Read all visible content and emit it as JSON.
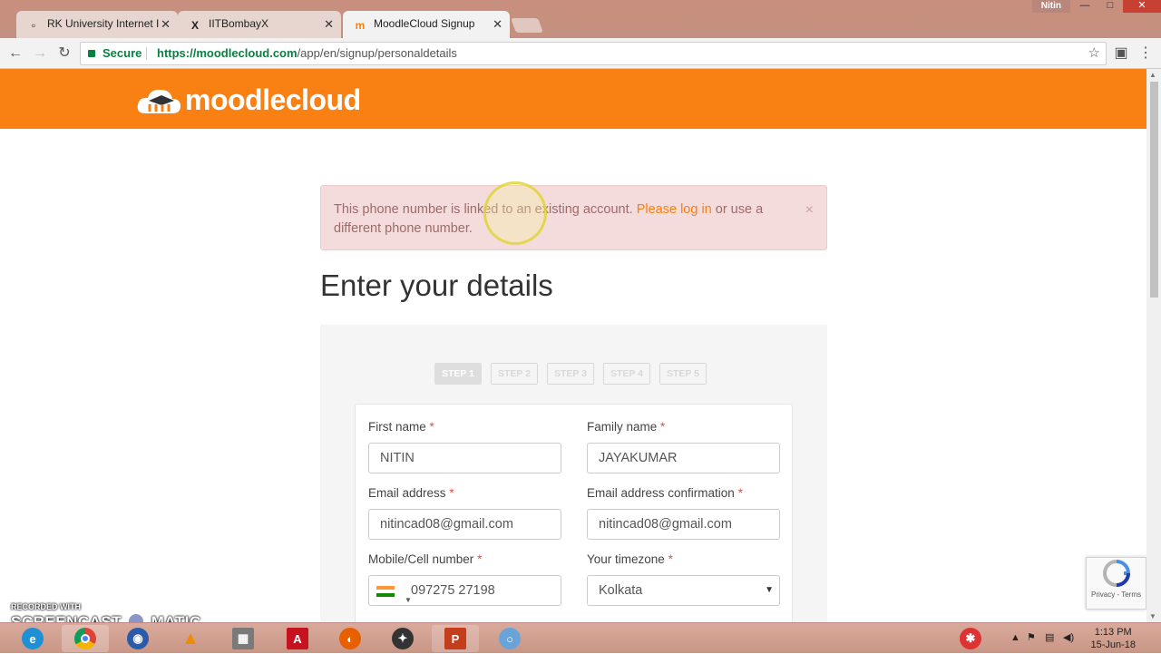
{
  "browser": {
    "tabs": [
      {
        "title": "RK University Internet I",
        "favicon": "page-icon",
        "active": false
      },
      {
        "title": "IITBombayX",
        "favicon": "x-icon",
        "active": false
      },
      {
        "title": "MoodleCloud Signup",
        "favicon": "moodle-icon",
        "active": true
      }
    ],
    "user": "Nitin",
    "secure_label": "Secure",
    "url_host": "https://moodlecloud.com",
    "url_path": "/app/en/signup/personaldetails"
  },
  "page": {
    "logo_text": "moodlecloud",
    "alert": {
      "text_before": "This phone number is linked to an existing account.",
      "link": "Please log in",
      "text_after": "or use a different phone number.",
      "close": "×"
    },
    "heading": "Enter your details",
    "steps": [
      "STEP 1",
      "STEP 2",
      "STEP 3",
      "STEP 4",
      "STEP 5"
    ],
    "active_step": 1,
    "required_mark": "*",
    "fields": {
      "first_name": {
        "label": "First name",
        "value": "NITIN"
      },
      "family_name": {
        "label": "Family name",
        "value": "JAYAKUMAR"
      },
      "email": {
        "label": "Email address",
        "value": "nitincad08@gmail.com"
      },
      "email_confirm": {
        "label": "Email address confirmation",
        "value": "nitincad08@gmail.com"
      },
      "mobile": {
        "label": "Mobile/Cell number",
        "value": "097275 27198",
        "country_flag": "india-flag-icon"
      },
      "timezone": {
        "label": "Your timezone",
        "value": "Kolkata"
      }
    },
    "recaptcha_text": "Privacy - Terms"
  },
  "colors": {
    "brand_orange": "#f98012",
    "alert_bg": "#f4dcdc",
    "secure_green": "#0b8043"
  },
  "watermark": {
    "top": "RECORDED WITH",
    "bottom": "SCREENCAST",
    "bottom2": "MATIC"
  },
  "taskbar": {
    "time": "1:13 PM",
    "date": "15-Jun-18"
  }
}
